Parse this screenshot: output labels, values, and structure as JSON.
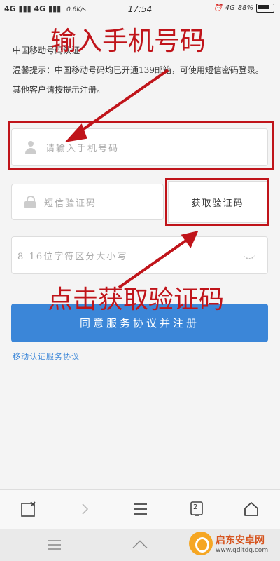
{
  "status_bar": {
    "signal_left": "4G",
    "signal_right": "4G",
    "speed": "0.6K/s",
    "time": "17:54",
    "network": "4G",
    "battery": "88%"
  },
  "notice": {
    "line1": "中国移动号码认证",
    "line2": "温馨提示：中国移动号码均已开通139邮箱，可使用短信密码登录。其他客户请按提示注册。"
  },
  "form": {
    "phone_placeholder": "请输入手机号码",
    "code_placeholder": "短信验证码",
    "get_code_label": "获取验证码",
    "password_placeholder": "8-16位字符区分大小写"
  },
  "register_button": "同意服务协议并注册",
  "agreement_link": "移动认证服务协议",
  "annotations": {
    "top": "输入手机号码",
    "bottom": "点击获取验证码",
    "color": "#c0141a"
  },
  "bottom_bar": {
    "icons": [
      "close-tab-icon",
      "forward-icon",
      "menu-icon",
      "tabs-icon",
      "home-icon"
    ],
    "tab_count": "2"
  },
  "watermark": {
    "name": "启东安卓网",
    "url": "www.qdltdq.com"
  },
  "colors": {
    "accent": "#3b86d8",
    "background": "#f4f4f4"
  }
}
